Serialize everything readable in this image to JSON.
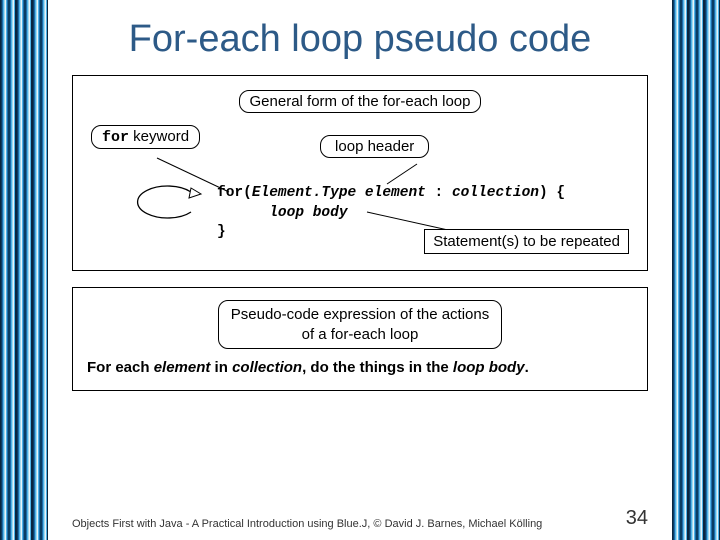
{
  "title": "For-each loop pseudo code",
  "box1": {
    "caption": "General form of the for-each loop",
    "for_keyword_label_prefix": "for",
    "for_keyword_label_suffix": " keyword",
    "loop_header_label": "loop header",
    "code_line1_a": "for(",
    "code_line1_b": "Element.Type element",
    "code_line1_c": " : ",
    "code_line1_d": "collection",
    "code_line1_e": ") {",
    "code_line2": "loop body",
    "code_line3": "}",
    "statement_label": "Statement(s) to be repeated"
  },
  "box2": {
    "caption_line1": "Pseudo-code expression of the actions",
    "caption_line2": "of a for-each loop",
    "sentence_parts": {
      "a": "For each ",
      "b": "element",
      "c": " in ",
      "d": "collection",
      "e": ", do the things in the ",
      "f": "loop body",
      "g": "."
    }
  },
  "footer": {
    "credit": "Objects First with Java - A Practical Introduction using Blue.J, © David J. Barnes, Michael Kölling",
    "page": "34"
  }
}
